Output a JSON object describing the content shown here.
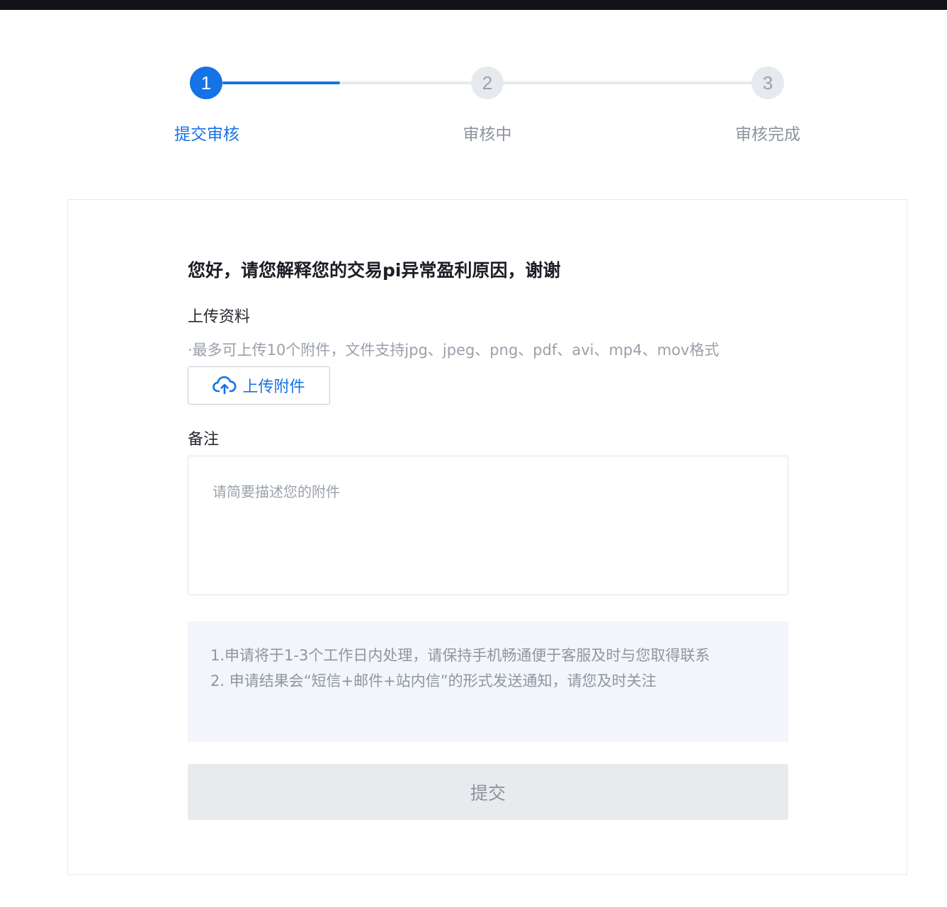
{
  "steps": [
    {
      "number": "1",
      "label": "提交审核",
      "state": "active"
    },
    {
      "number": "2",
      "label": "审核中",
      "state": "inactive"
    },
    {
      "number": "3",
      "label": "审核完成",
      "state": "inactive"
    }
  ],
  "form": {
    "title": "您好，请您解释您的交易pi异常盈利原因，谢谢",
    "upload_label": "上传资料",
    "upload_hint": "·最多可上传10个附件，文件支持jpg、jpeg、png、pdf、avi、mp4、mov格式",
    "upload_button": "上传附件",
    "remark_label": "备注",
    "remark_placeholder": "请简要描述您的附件",
    "remark_value": "",
    "notice_lines": [
      "1.申请将于1-3个工作日内处理，请保持手机畅通便于客服及时与您取得联系",
      "2. 申请结果会“短信+邮件+站内信”的形式发送通知，请您及时关注"
    ],
    "submit_button": "提交"
  },
  "colors": {
    "accent": "#1473e6",
    "inactive_step": "#e6e9ee",
    "topbar": "#121218"
  },
  "icons": {
    "upload": "cloud-upload-icon"
  }
}
